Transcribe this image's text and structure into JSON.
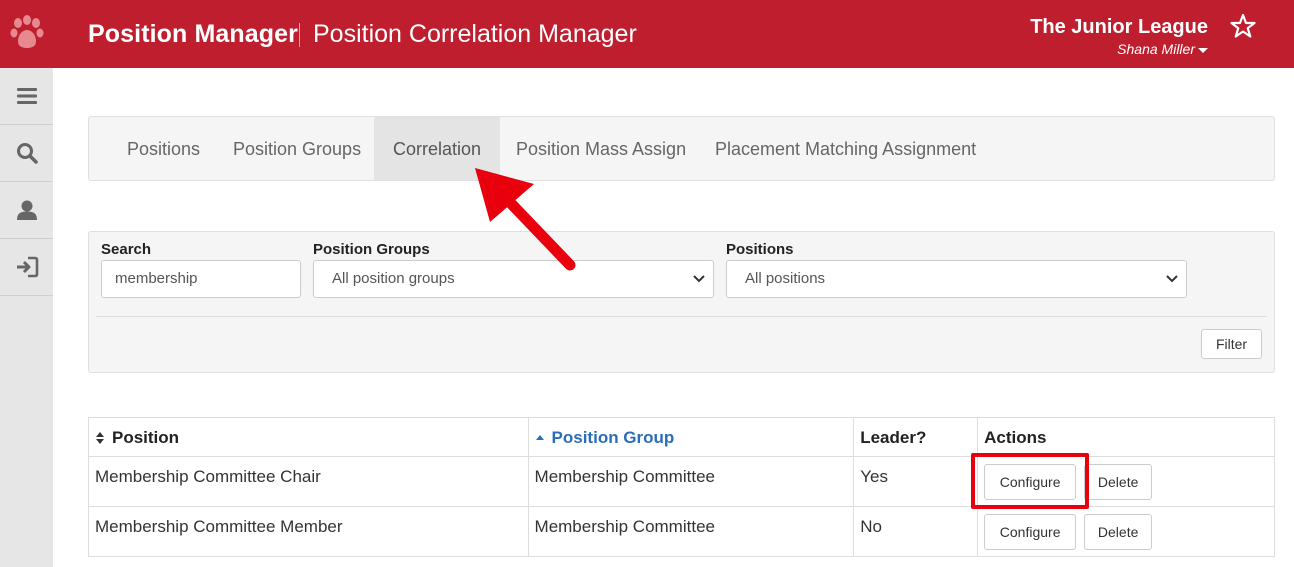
{
  "header": {
    "app_title": "Position Manager",
    "page_title": "Position Correlation Manager",
    "org_name": "The Junior League",
    "user_name": "Shana Miller",
    "brand_color": "#bf1e2e",
    "logo_icon": "paw-icon",
    "favorite_icon": "star-outline-icon"
  },
  "sidebar": {
    "items": [
      {
        "icon": "menu-icon"
      },
      {
        "icon": "search-icon"
      },
      {
        "icon": "user-icon"
      },
      {
        "icon": "sign-out-icon"
      }
    ]
  },
  "tabs": [
    {
      "label": "Positions",
      "active": false
    },
    {
      "label": "Position Groups",
      "active": false
    },
    {
      "label": "Correlation",
      "active": true
    },
    {
      "label": "Position Mass Assign",
      "active": false
    },
    {
      "label": "Placement Matching Assignment",
      "active": false
    }
  ],
  "filters": {
    "search_label": "Search",
    "search_value": "membership",
    "groups_label": "Position Groups",
    "groups_value": "All position groups",
    "positions_label": "Positions",
    "positions_value": "All positions",
    "filter_button": "Filter"
  },
  "table": {
    "columns": [
      "Position",
      "Position Group",
      "Leader?",
      "Actions"
    ],
    "sorted_column_color": "#2a6ebb",
    "rows": [
      {
        "position": "Membership Committee Chair",
        "group": "Membership Committee",
        "leader": "Yes",
        "configure": "Configure",
        "delete": "Delete"
      },
      {
        "position": "Membership Committee Member",
        "group": "Membership Committee",
        "leader": "No",
        "configure": "Configure",
        "delete": "Delete"
      }
    ]
  },
  "annotations": {
    "highlight_color": "#e8000d"
  }
}
